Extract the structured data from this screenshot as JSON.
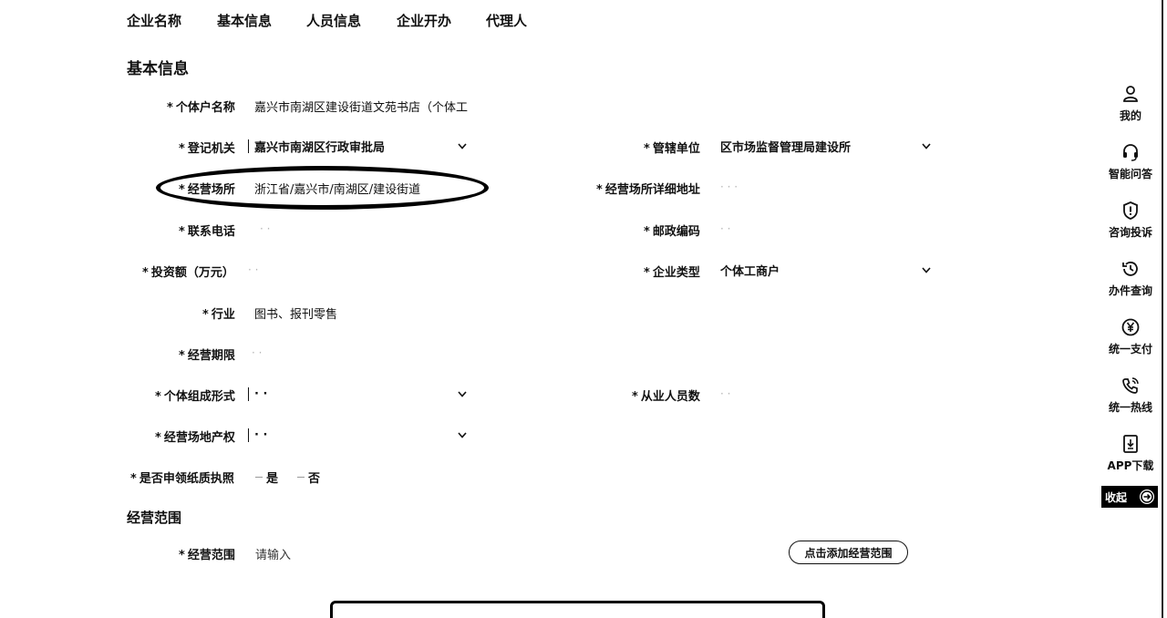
{
  "tabs": [
    {
      "label": "企业名称"
    },
    {
      "label": "基本信息"
    },
    {
      "label": "人员信息"
    },
    {
      "label": "企业开办"
    },
    {
      "label": "代理人"
    }
  ],
  "section_basic": {
    "title": "基本信息"
  },
  "section_scope": {
    "title": "经营范围"
  },
  "form": {
    "required_mark": "*",
    "household_name": {
      "label": "个体户名称",
      "value": "嘉兴市南湖区建设街道文苑书店（个体工"
    },
    "registration_authority": {
      "label": "登记机关",
      "value": "嘉兴市南湖区行政审批局"
    },
    "supervising_unit": {
      "label": "管辖单位",
      "value": "区市场监督管理局建设所"
    },
    "business_premises": {
      "label": "经营场所",
      "value": "浙江省/嘉兴市/南湖区/建设街道"
    },
    "premises_address": {
      "label": "经营场所详细地址",
      "value": "·   ·   ·"
    },
    "phone": {
      "label": "联系电话",
      "value": "·   ·"
    },
    "postal_code": {
      "label": "邮政编码",
      "value": "·   ·"
    },
    "investment": {
      "label": "投资额（万元）",
      "value": "·   ·"
    },
    "enterprise_type": {
      "label": "企业类型",
      "value": "个体工商户"
    },
    "industry": {
      "label": "行业",
      "value": "图书、报刊零售"
    },
    "business_term": {
      "label": "经营期限",
      "value": "·   ·"
    },
    "organization_form": {
      "label": "个体组成形式",
      "value": "·   ·"
    },
    "employee_count": {
      "label": "从业人员数",
      "value": "·   ·"
    },
    "premises_ownership": {
      "label": "经营场地产权",
      "value": "·   ·"
    },
    "paper_license": {
      "label": "是否申领纸质执照",
      "options": [
        "是",
        "否"
      ]
    },
    "business_scope": {
      "label": "经营范围",
      "placeholder": "请输入"
    }
  },
  "add_scope_button": {
    "label": "点击添加经营范围"
  },
  "sidebar": {
    "items": [
      {
        "label": "我的",
        "icon": "user-icon"
      },
      {
        "label": "智能问答",
        "icon": "headset-icon"
      },
      {
        "label": "咨询投诉",
        "icon": "shield-icon"
      },
      {
        "label": "办件查询",
        "icon": "history-icon"
      },
      {
        "label": "统一支付",
        "icon": "yen-icon"
      },
      {
        "label": "统一热线",
        "icon": "phone-icon"
      },
      {
        "label": "APP下载",
        "icon": "download-icon"
      }
    ],
    "collapse_label": "收起"
  }
}
